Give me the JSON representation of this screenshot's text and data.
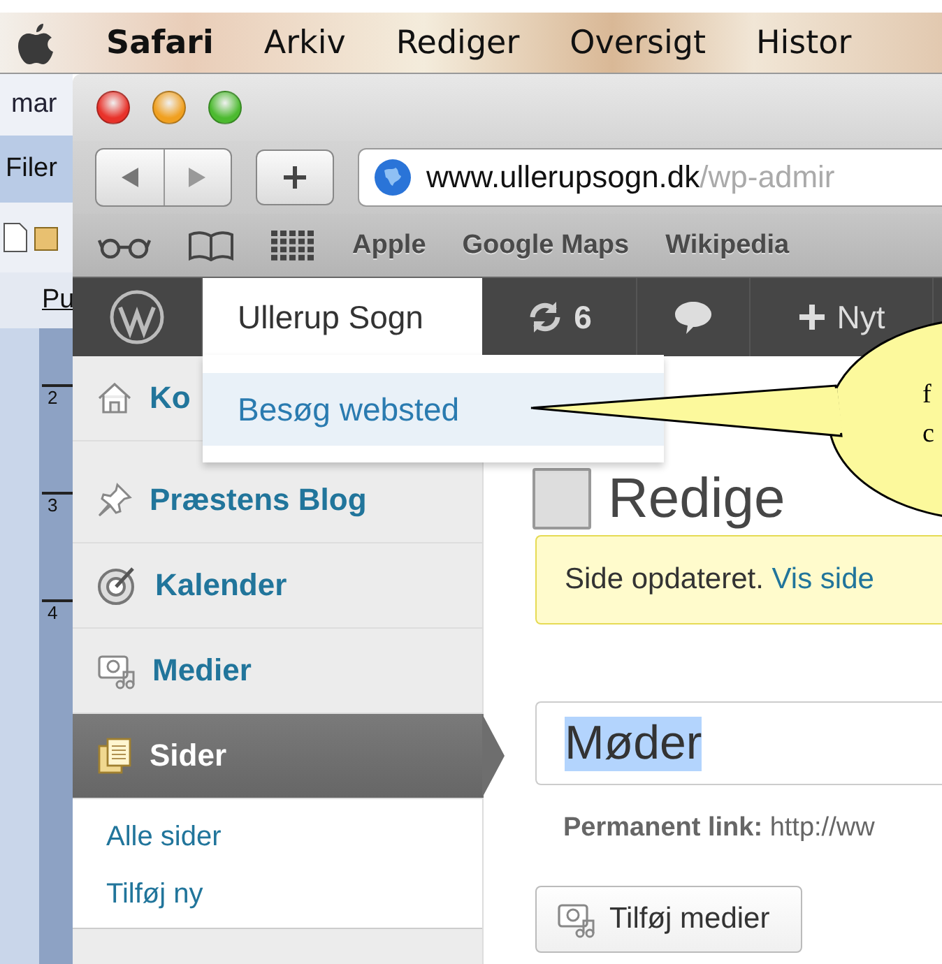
{
  "menu_bar": {
    "items": [
      {
        "label": "Safari",
        "bold": true
      },
      {
        "label": "Arkiv",
        "bold": false
      },
      {
        "label": "Rediger",
        "bold": false
      },
      {
        "label": "Oversigt",
        "bold": false
      },
      {
        "label": "Histor",
        "bold": false
      }
    ]
  },
  "background_app": {
    "tab": "mar",
    "menu": "Filer",
    "toolbar_label": "Pu",
    "ruler_marks": [
      "2",
      "3",
      "4"
    ]
  },
  "browser": {
    "url_domain": "www.ullerupsogn.dk",
    "url_path": "/wp-admir",
    "bookmarks": [
      "Apple",
      "Google Maps",
      "Wikipedia"
    ]
  },
  "admin_bar": {
    "site_name": "Ullerup Sogn",
    "updates": "6",
    "new_label": "Nyt",
    "dropdown": [
      {
        "label": "Besøg websted",
        "selected": true
      }
    ]
  },
  "sidebar": {
    "items": [
      {
        "label": "Ko",
        "selected": false
      },
      {
        "label": "Præstens Blog",
        "selected": false
      },
      {
        "label": "Kalender",
        "selected": false
      },
      {
        "label": "Medier",
        "selected": false
      },
      {
        "label": "Sider",
        "selected": true
      }
    ],
    "submenu": [
      "Alle sider",
      "Tilføj ny"
    ]
  },
  "content": {
    "heading": "Redige",
    "notice": "Side opdateret.",
    "notice_link": "Vis side",
    "title_value": "Møder",
    "permalink_label": "Permanent link:",
    "permalink_value": "http://ww",
    "media_button": "Tilføj medier"
  },
  "callout": {
    "lines": [
      "f",
      "c"
    ]
  }
}
